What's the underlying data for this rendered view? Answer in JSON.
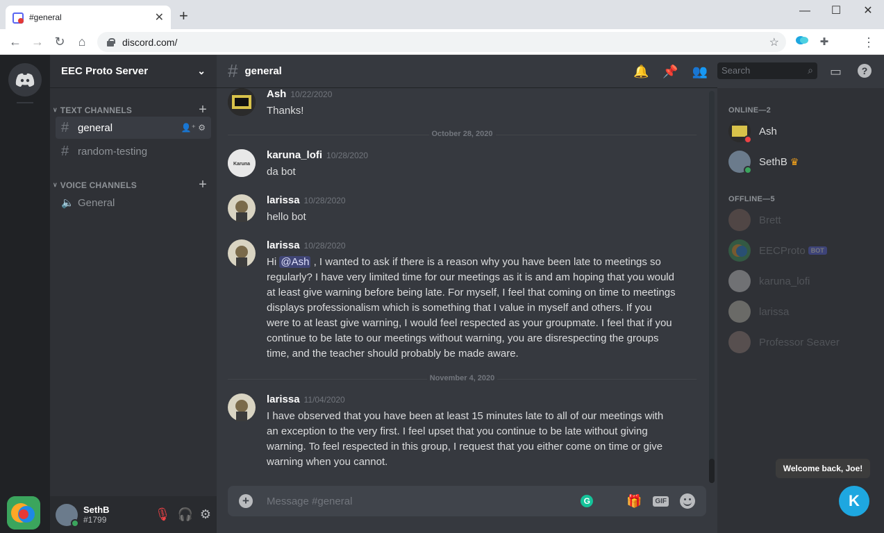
{
  "browser": {
    "tab_title": "#general",
    "url": "discord.com/",
    "colors": {
      "tab_bg": "#dee1e6",
      "omnibox": "#f1f3f4"
    }
  },
  "server": {
    "name": "EEC Proto Server",
    "text_category": "TEXT CHANNELS",
    "voice_category": "VOICE CHANNELS",
    "text_channels": [
      {
        "name": "general",
        "active": true
      },
      {
        "name": "random-testing",
        "active": false
      }
    ],
    "voice_channels": [
      {
        "name": "General"
      }
    ]
  },
  "user_panel": {
    "name": "SethB",
    "tag": "#1799"
  },
  "channel": {
    "name": "general",
    "search_placeholder": "Search",
    "composer_placeholder": "Message #general"
  },
  "messages": [
    {
      "author": "Ash",
      "timestamp": "10/22/2020",
      "text": "Thanks!"
    },
    {
      "divider": "October 28, 2020"
    },
    {
      "author": "karuna_lofi",
      "timestamp": "10/28/2020",
      "text": "da bot"
    },
    {
      "author": "larissa",
      "timestamp": "10/28/2020",
      "text": "hello bot"
    },
    {
      "author": "larissa",
      "timestamp": "10/28/2020",
      "mention": "@Ash",
      "text_before": "Hi",
      "text_after": ", I wanted to ask if there is a reason why you have been late to meetings so regularly? I have very limited time for our meetings as it is and am hoping that you would at least give warning before being late. For myself, I feel that coming on time to meetings displays professionalism which is something that I value in myself and others. If you were to at least give warning, I would feel respected as your groupmate. I feel that if you continue to be late to our meetings without warning, you are disrespecting the groups time, and the teacher should probably be made aware."
    },
    {
      "divider": "November 4, 2020"
    },
    {
      "author": "larissa",
      "timestamp": "11/04/2020",
      "text": "I have observed that you have been at least 15 minutes late to all of our meetings with an exception to the very first. I feel upset that you continue to be late without giving warning. To feel respected in this group, I request that you either come on time or give warning when you cannot."
    }
  ],
  "members": {
    "online_header": "ONLINE—2",
    "offline_header": "OFFLINE—5",
    "online": [
      {
        "name": "Ash",
        "status": "dnd"
      },
      {
        "name": "SethB",
        "status": "online",
        "owner": true
      }
    ],
    "offline": [
      {
        "name": "Brett"
      },
      {
        "name": "EECProto",
        "bot": "BOT"
      },
      {
        "name": "karuna_lofi"
      },
      {
        "name": "larissa"
      },
      {
        "name": "Professor Seaver"
      }
    ]
  },
  "overlay": {
    "welcome": "Welcome back, Joe!",
    "k_logo": "K"
  },
  "icons": {
    "discord_logo": "discord-logo-icon",
    "add": "add-icon"
  },
  "theme": {
    "bg": "#36393f",
    "sidebar": "#2f3136",
    "guilds": "#202225",
    "accent": "#5865f2"
  }
}
